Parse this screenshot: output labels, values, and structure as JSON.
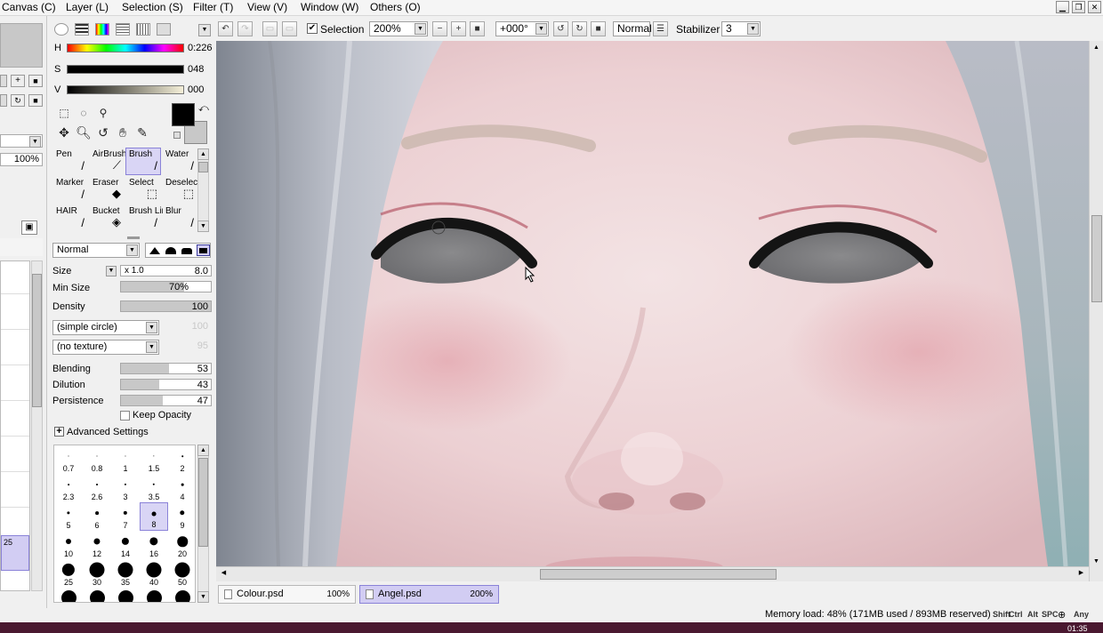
{
  "menu": {
    "items": [
      "Canvas (C)",
      "Layer (L)",
      "Selection (S)",
      "Filter (T)",
      "View (V)",
      "Window (W)",
      "Others (O)"
    ]
  },
  "window_controls": [
    "minimize",
    "restore",
    "close"
  ],
  "left_strip": {
    "zoom_value": "100%",
    "layer_number": "25"
  },
  "color": {
    "h_label": "H",
    "h_value": "0:226",
    "s_label": "S",
    "s_value": "048",
    "v_label": "V",
    "v_value": "000",
    "primary": "#000000",
    "secondary": "#c8c8c8"
  },
  "brushes": [
    {
      "name": "Pen",
      "glyph": "✒"
    },
    {
      "name": "AirBrush",
      "glyph": "✈"
    },
    {
      "name": "Brush",
      "glyph": "✎",
      "selected": true
    },
    {
      "name": "Water",
      "glyph": "💧"
    },
    {
      "name": "Marker",
      "glyph": "✎"
    },
    {
      "name": "Eraser",
      "glyph": "▰"
    },
    {
      "name": "Select",
      "glyph": "⬚"
    },
    {
      "name": "Deselect",
      "glyph": "⬚"
    },
    {
      "name": "HAIR",
      "glyph": "✎"
    },
    {
      "name": "Bucket",
      "glyph": "⛾"
    },
    {
      "name": "Brush Lin",
      "glyph": "✎"
    },
    {
      "name": "Blur",
      "glyph": "✎"
    }
  ],
  "blend_mode": "Normal",
  "params": {
    "size_label": "Size",
    "size_mult": "x 1.0",
    "size_value": "8.0",
    "min_size_label": "Min Size",
    "min_size_value": "70%",
    "density_label": "Density",
    "density_value": "100",
    "shape": "(simple circle)",
    "shape_value": "100",
    "texture": "(no texture)",
    "texture_value": "95",
    "blending_label": "Blending",
    "blending_value": "53",
    "dilution_label": "Dilution",
    "dilution_value": "43",
    "persistence_label": "Persistence",
    "persistence_value": "47",
    "keep_opacity": "Keep Opacity",
    "advanced": "Advanced Settings"
  },
  "brush_sizes": [
    "0.7",
    "0.8",
    "1",
    "1.5",
    "2",
    "2.3",
    "2.6",
    "3",
    "3.5",
    "4",
    "5",
    "6",
    "7",
    "8",
    "9",
    "10",
    "12",
    "14",
    "16",
    "20",
    "25",
    "30",
    "35",
    "40",
    "50"
  ],
  "selected_size": "8",
  "toolbar": {
    "selection_label": "Selection",
    "zoom": "200%",
    "rotation": "+000°",
    "blend": "Normal",
    "stabilizer_label": "Stabilizer",
    "stabilizer_value": "3"
  },
  "tabs": [
    {
      "name": "Colour.psd",
      "zoom": "100%"
    },
    {
      "name": "Angel.psd",
      "zoom": "200%",
      "active": true
    }
  ],
  "status": {
    "memory": "Memory load: 48% (171MB used / 893MB reserved)",
    "keys": [
      "Shift",
      "Ctrl",
      "Alt",
      "SPC",
      "Any"
    ],
    "time": "01:35"
  }
}
